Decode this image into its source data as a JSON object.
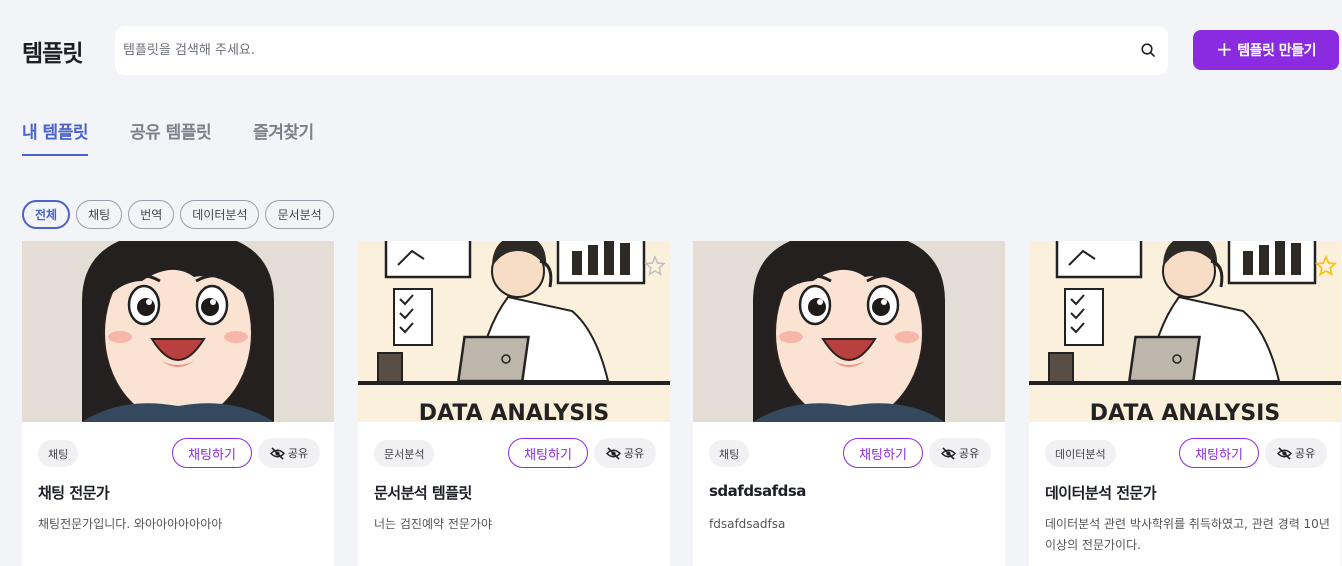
{
  "header": {
    "title": "템플릿",
    "search_placeholder": "템플릿을 검색해 주세요.",
    "create_label": "템플릿 만들기"
  },
  "tabs": [
    {
      "label": "내 템플릿",
      "active": true
    },
    {
      "label": "공유 템플릿",
      "active": false
    },
    {
      "label": "즐겨찾기",
      "active": false
    }
  ],
  "filters": [
    {
      "label": "전체",
      "active": true
    },
    {
      "label": "채팅",
      "active": false
    },
    {
      "label": "번역",
      "active": false
    },
    {
      "label": "데이터분석",
      "active": false
    },
    {
      "label": "문서분석",
      "active": false
    }
  ],
  "cards": [
    {
      "image": "girl-avatar",
      "category": "채팅",
      "chat_label": "채팅하기",
      "share_label": "공유",
      "title": "채팅 전문가",
      "description": "채팅전문가입니다. 와아아아아아아아",
      "favorited": false,
      "star_visible": false
    },
    {
      "image": "data-analysis-illustration",
      "category": "문서분석",
      "chat_label": "채팅하기",
      "share_label": "공유",
      "title": "문서분석 템플릿",
      "description": "너는 검진예약 전문가야",
      "favorited": false,
      "star_visible": true
    },
    {
      "image": "girl-avatar",
      "category": "채팅",
      "chat_label": "채팅하기",
      "share_label": "공유",
      "title": "sdafdsafdsa",
      "description": "fdsafdsadfsa",
      "favorited": false,
      "star_visible": false
    },
    {
      "image": "data-analysis-illustration",
      "category": "데이터분석",
      "chat_label": "채팅하기",
      "share_label": "공유",
      "title": "데이터분석 전문가",
      "description": "데이터분석 관련 박사학위를 취득하였고, 관련 경력 10년 이상의 전문가이다.",
      "favorited": true,
      "star_visible": true
    }
  ],
  "illustration_text": "DATA ANALYSIS",
  "colors": {
    "accent": "#8a2be2",
    "tab_active": "#4a63c9",
    "background": "#f3f4f7",
    "star_favorited": "#f5c518"
  }
}
